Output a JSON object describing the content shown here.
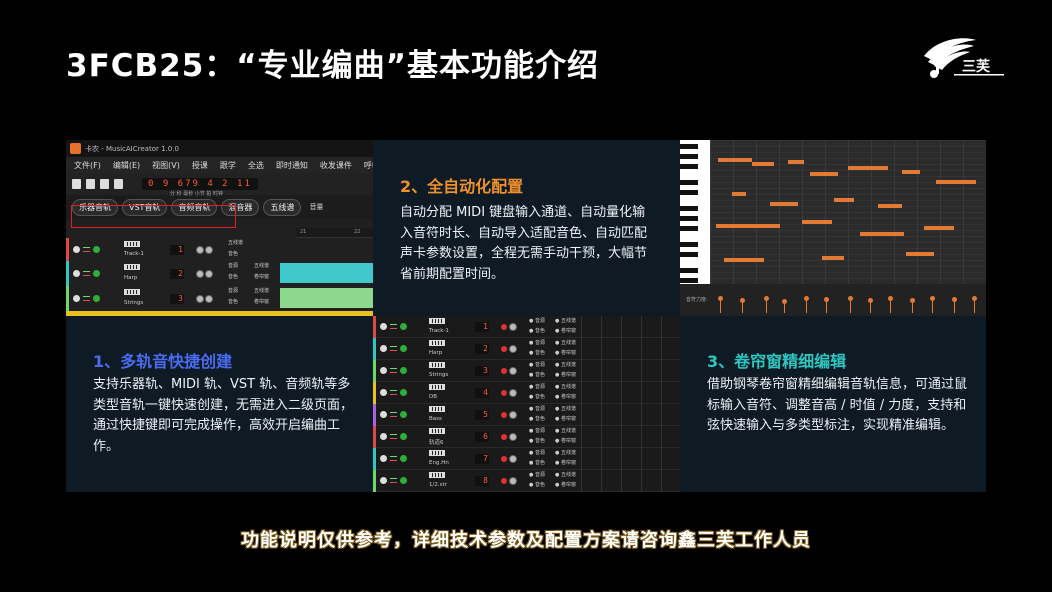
{
  "slide": {
    "title": "3FCB25：“专业编曲”基本功能介绍",
    "logo_text": "三芙",
    "footer": "功能说明仅供参考，详细技术参数及配置方案请咨询鑫三芙工作人员"
  },
  "features": [
    {
      "heading": "1、多轨音快捷创建",
      "color": "#4a6cf0",
      "body": "支持乐器轨、MIDI 轨、VST 轨、音频轨等多类型音轨一键快速创建，无需进入二级页面，通过快捷键即可完成操作，高效开启编曲工作。"
    },
    {
      "heading": "2、全自动化配置",
      "color": "#f0902a",
      "body": "自动分配 MIDI 键盘输入通道、自动量化输入音符时长、自动导入适配音色、自动匹配声卡参数设置，全程无需手动干预，大幅节省前期配置时间。"
    },
    {
      "heading": "3、卷帘窗精细编辑",
      "color": "#2ec6c0",
      "body": "借助钢琴卷帘窗精细编辑音轨信息，可通过鼠标输入音符、调整音高 / 时值 / 力度，支持和弦快速输入与多类型标注，实现精准编辑。"
    }
  ],
  "app": {
    "window_title": "卡农 - MusicAICreator 1.0.0",
    "menu": [
      "文件(F)",
      "编辑(E)",
      "视图(V)",
      "授课",
      "跟学",
      "全选",
      "即时通知",
      "收发课件",
      "呼叫"
    ],
    "time_value": "0 9 679  4 2 11",
    "time_labels": "分   秒   毫秒   小节   拍   时钟",
    "buttons": [
      "乐器音轨",
      "VST音轨",
      "音频音轨",
      "混音器",
      "五线谱"
    ],
    "volume_label": "音量",
    "ruler": [
      "21",
      "22"
    ],
    "track_options": [
      "音源",
      "五线谱",
      "音色",
      "卷帘窗"
    ],
    "tracks_top": [
      {
        "name": "Track-1",
        "num": "1"
      },
      {
        "name": "Harp",
        "num": "2"
      },
      {
        "name": "Strings",
        "num": "3"
      }
    ],
    "tracks_bottom": [
      {
        "name": "Track-1",
        "num": "1"
      },
      {
        "name": "Harp",
        "num": "2"
      },
      {
        "name": "Strings",
        "num": "3"
      },
      {
        "name": "DB",
        "num": "4"
      },
      {
        "name": "Bass",
        "num": "5"
      },
      {
        "name": "轨道6",
        "num": "6"
      },
      {
        "name": "Eng.Hn",
        "num": "7"
      },
      {
        "name": "1/2.str",
        "num": "8"
      }
    ],
    "velocity_label": "音符力度:"
  },
  "colors": {
    "accent_orange": "#e07a34",
    "record_red": "#e03030",
    "outline_red": "#e02020"
  }
}
